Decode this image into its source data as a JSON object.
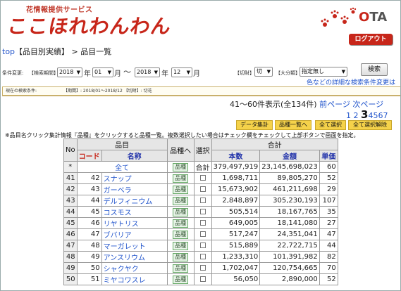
{
  "header": {
    "subtitle": "花情報提供サービス",
    "logo_text": "ここほれわんわん",
    "ota_o": "O",
    "ota_rest": "TA",
    "logout_label": "ログアウト"
  },
  "breadcrumb": {
    "top": "top",
    "middle": "【品目別実績】",
    "sep": ">",
    "current": "品目一覧"
  },
  "search": {
    "cond_label": "条件変更:",
    "period_label": "【検索期間】",
    "from_year": "2018",
    "from_year_unit": "年",
    "from_month": "01",
    "from_month_unit": "月",
    "tilde": "～",
    "to_year": "2018",
    "to_year_unit": "年",
    "to_month": "12",
    "to_month_unit": "月",
    "cut_label": "【切財】",
    "cut_value": "切",
    "category_label": "【大分類】",
    "category_value": "指定無し",
    "search_button": "検索",
    "detail_link": "色などの詳細な検索条件変更はこちら"
  },
  "current_condition": {
    "label": "現在の検索条件:",
    "value": "【期間】: 2018/01～2018/12 【切財】: 切花"
  },
  "pager": {
    "range_text": "41～60件表示(全134件)",
    "prev": "前ページ",
    "next": "次ページ",
    "pages": [
      "1",
      "2",
      "3",
      "4",
      "5",
      "6",
      "7"
    ],
    "current": "3"
  },
  "actions": {
    "data_agg": "データ集計",
    "item_list": "品種一覧へ",
    "select_all": "全て選択",
    "deselect_all": "全て選択解除"
  },
  "note": "※品目名クリック集計情報『品種』をクリックすると品種一覧。複数選択したい場合はチェック欄をチェックして上部ボタンで画面を指定。",
  "table": {
    "h_no": "No",
    "h_item": "品目",
    "h_code": "コード",
    "h_name": "名称",
    "h_hinshu": "品種へ",
    "h_select": "選択",
    "h_total": "合計",
    "h_count": "本数",
    "h_amount": "金額",
    "h_price": "単価",
    "total_row": {
      "no": "*",
      "name": "全て",
      "hin": "品種",
      "sel": "合計",
      "count": "379,497,919",
      "amount": "23,145,698,023",
      "price": "60"
    },
    "rows": [
      {
        "no": "41",
        "code": "42",
        "name": "スナップ",
        "hin": "品種",
        "count": "1,698,711",
        "amount": "89,805,270",
        "price": "52"
      },
      {
        "no": "42",
        "code": "43",
        "name": "ガーベラ",
        "hin": "品種",
        "count": "15,673,902",
        "amount": "461,211,698",
        "price": "29"
      },
      {
        "no": "43",
        "code": "44",
        "name": "デルフィニウム",
        "hin": "品種",
        "count": "2,848,897",
        "amount": "305,230,193",
        "price": "107"
      },
      {
        "no": "44",
        "code": "45",
        "name": "コスモス",
        "hin": "品種",
        "count": "505,514",
        "amount": "18,167,765",
        "price": "35"
      },
      {
        "no": "45",
        "code": "46",
        "name": "リヤトリス",
        "hin": "品種",
        "count": "649,005",
        "amount": "18,141,080",
        "price": "27"
      },
      {
        "no": "46",
        "code": "47",
        "name": "ブバリア",
        "hin": "品種",
        "count": "517,247",
        "amount": "24,351,041",
        "price": "47"
      },
      {
        "no": "47",
        "code": "48",
        "name": "マーガレット",
        "hin": "品種",
        "count": "515,889",
        "amount": "22,722,715",
        "price": "44"
      },
      {
        "no": "48",
        "code": "49",
        "name": "アンスリウム",
        "hin": "品種",
        "count": "1,233,310",
        "amount": "101,391,982",
        "price": "82"
      },
      {
        "no": "49",
        "code": "50",
        "name": "シャクヤク",
        "hin": "品種",
        "count": "1,702,047",
        "amount": "120,754,665",
        "price": "70"
      },
      {
        "no": "50",
        "code": "51",
        "name": "ミヤコワスレ",
        "hin": "品種",
        "count": "56,050",
        "amount": "2,890,000",
        "price": "52"
      }
    ]
  },
  "colors": {
    "brand_red": "#c7261a",
    "link_blue": "#2255cc",
    "action_yellow": "#f5d24a"
  }
}
